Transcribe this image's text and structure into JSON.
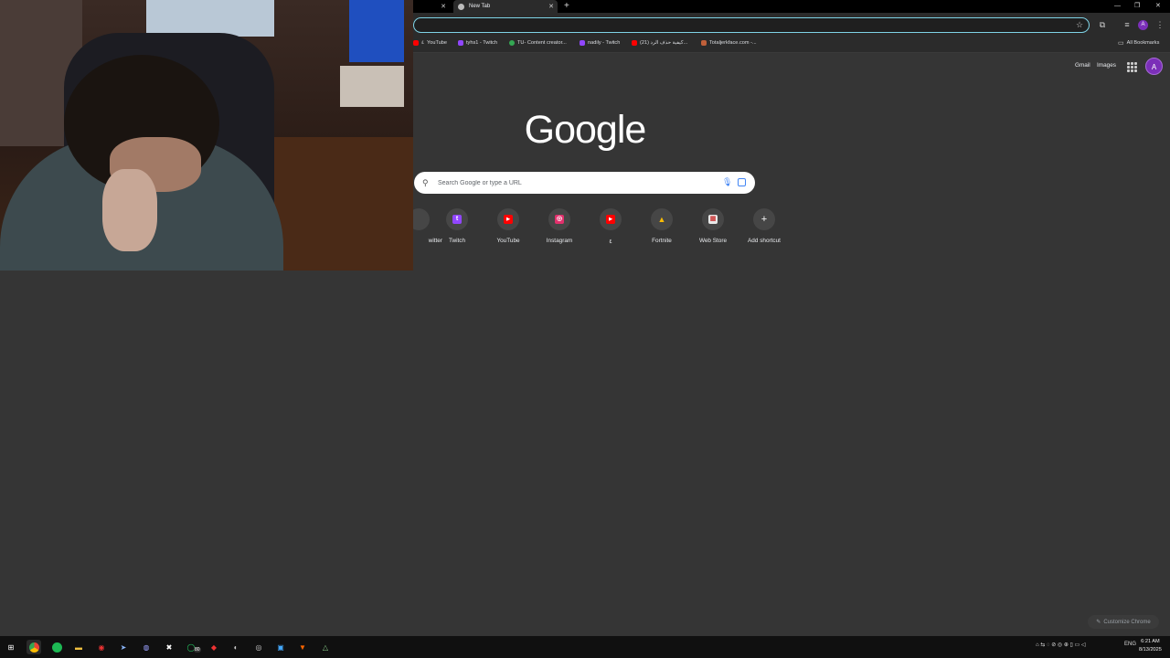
{
  "tabs": [
    {
      "label": "",
      "active": false
    },
    {
      "label": "New Tab",
      "active": true
    }
  ],
  "bookmarks": [
    {
      "label": "YouTube",
      "prefix": "٤",
      "color": "#ff0000"
    },
    {
      "label": "tyhs1 - Twitch",
      "color": "#9146ff"
    },
    {
      "label": "TU- Content creator...",
      "color": "#34a853"
    },
    {
      "label": "nadily - Twitch",
      "color": "#9146ff"
    },
    {
      "label": "(21) كيفية حذف الرد...",
      "color": "#ff0000"
    },
    {
      "label": "Totaljerkface.com -...",
      "color": "#c0603a"
    }
  ],
  "all_bookmarks": "All Bookmarks",
  "ntp": {
    "gmail": "Gmail",
    "images": "Images",
    "avatar": "A",
    "logo": "Google",
    "search_placeholder": "Search Google or type a URL",
    "customize": "Customize Chrome"
  },
  "shortcuts": [
    {
      "label": "witter",
      "icon": "twitter-icon",
      "color": "#1d9bf0",
      "glyph": ""
    },
    {
      "label": "Twitch",
      "icon": "twitch-icon",
      "color": "#9146ff",
      "glyph": "t"
    },
    {
      "label": "YouTube",
      "icon": "youtube-icon",
      "color": "#ff0000",
      "glyph": "▶"
    },
    {
      "label": "Instagram",
      "icon": "instagram-icon",
      "color": "#e1306c",
      "glyph": "◎"
    },
    {
      "label": "٤",
      "icon": "youtube-icon",
      "color": "#ff0000",
      "glyph": "▶"
    },
    {
      "label": "Fortnite",
      "icon": "google-drive-icon",
      "color": "#34a853",
      "glyph": "▲"
    },
    {
      "label": "Web Store",
      "icon": "web-store-icon",
      "color": "#c44",
      "glyph": "▦"
    },
    {
      "label": "Add shortcut",
      "icon": "plus-icon",
      "color": "transparent",
      "glyph": "+"
    }
  ],
  "taskbar": {
    "lang": "ENG",
    "time": "6:21 AM",
    "date": "8/13/2025",
    "badge": "80"
  }
}
